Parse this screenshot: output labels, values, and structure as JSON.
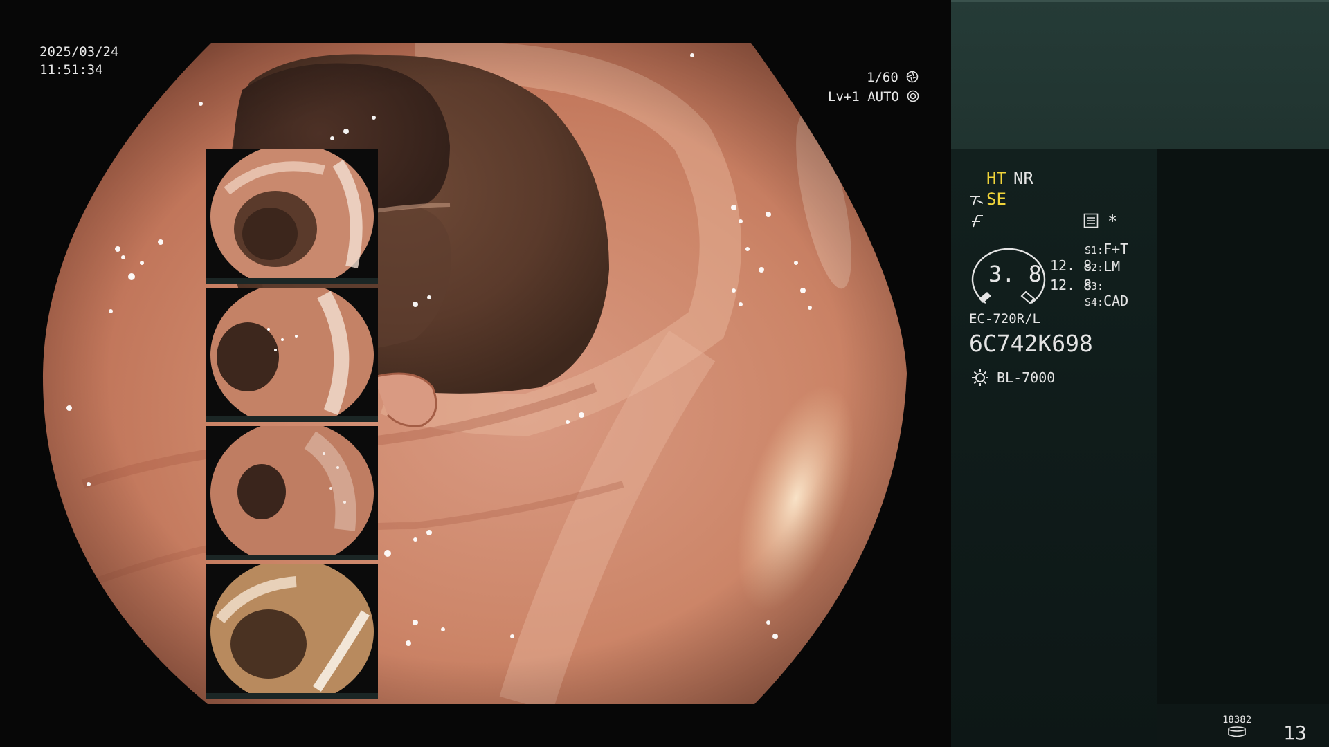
{
  "viewer": {
    "date": "2025/03/24",
    "time": "11:51:34",
    "shutter": "1/60",
    "level_mode": "Lv+1 AUTO"
  },
  "sidebar": {
    "mode_ht": "HT",
    "mode_nr": "NR",
    "mode_se": "SE",
    "zoom_value": "3. 8",
    "value_a": "12. 8",
    "value_b": "12. 8",
    "s1_label": "S1:",
    "s1_value": "F+T",
    "s2_label": "S2:",
    "s2_value": "LM",
    "s3_label": "S3:",
    "s3_value": "",
    "s4_label": "S4:",
    "s4_value": "CAD",
    "scope_model": "EC-720R/L",
    "scope_serial": "6C742K698",
    "light_source": "BL-7000",
    "storage_count": "18382",
    "capture_count": "13"
  },
  "icons": {
    "shutter": "aperture-icon",
    "auto": "target-icon",
    "magnify": "magnify-icon",
    "filter": "filter-icon",
    "menu": "menu-card-icon",
    "asterisk": "asterisk-icon",
    "light": "sun-icon",
    "storage": "storage-icon"
  },
  "colors": {
    "accent_yellow": "#f0d43a",
    "panel_top": "#253b37",
    "panel_bottom": "#0e1716"
  }
}
